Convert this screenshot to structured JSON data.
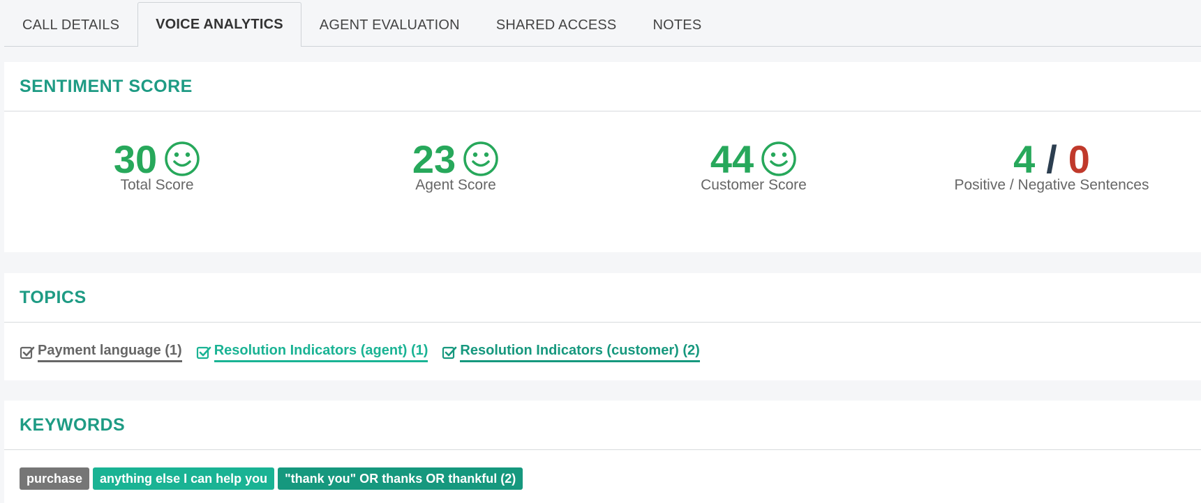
{
  "tabs": [
    {
      "label": "CALL DETAILS",
      "active": false
    },
    {
      "label": "VOICE ANALYTICS",
      "active": true
    },
    {
      "label": "AGENT EVALUATION",
      "active": false
    },
    {
      "label": "SHARED ACCESS",
      "active": false
    },
    {
      "label": "NOTES",
      "active": false
    }
  ],
  "sentiment": {
    "title": "SENTIMENT SCORE",
    "scores": [
      {
        "value": "30",
        "label": "Total Score",
        "icon": "smiley-icon"
      },
      {
        "value": "23",
        "label": "Agent Score",
        "icon": "smiley-icon"
      },
      {
        "value": "44",
        "label": "Customer Score",
        "icon": "smiley-icon"
      }
    ],
    "sentences": {
      "positive": "4",
      "separator": "/",
      "negative": "0",
      "label": "Positive / Negative Sentences"
    }
  },
  "topics": {
    "title": "TOPICS",
    "items": [
      {
        "label": "Payment language (1)",
        "color": "#666666",
        "icon": "checkbox-checked-icon"
      },
      {
        "label": "Resolution Indicators (agent) (1)",
        "color": "#1ab394",
        "icon": "checkbox-checked-icon"
      },
      {
        "label": "Resolution Indicators (customer) (2)",
        "color": "#16987e",
        "icon": "checkbox-checked-icon"
      }
    ]
  },
  "keywords": {
    "title": "KEYWORDS",
    "items": [
      {
        "label": "purchase",
        "color": "#767676"
      },
      {
        "label": "anything else I can help you",
        "color": "#1ab394"
      },
      {
        "label": "\"thank you\" OR thanks OR thankful (2)",
        "color": "#16987e"
      }
    ]
  },
  "colors": {
    "accent": "#1e9b84",
    "positive": "#27a85b",
    "negative": "#c0392b"
  }
}
